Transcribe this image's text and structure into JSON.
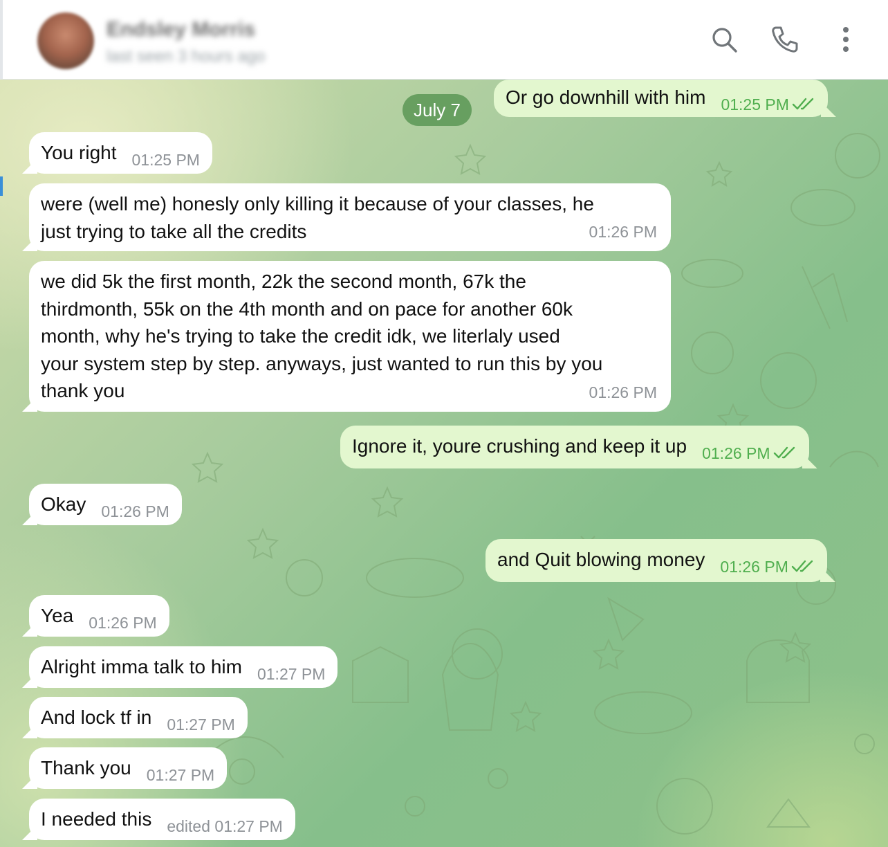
{
  "header": {
    "contact_name": "Endsley Morris",
    "contact_status": "last seen 3 hours ago"
  },
  "chat": {
    "date_divider": "July 7",
    "messages": [
      {
        "dir": "out",
        "text": "Or go downhill with him",
        "time": "01:25 PM",
        "read": true
      },
      {
        "dir": "in",
        "text": "You right",
        "time": "01:25 PM"
      },
      {
        "dir": "in",
        "lines": [
          "were (well me) honesly only killing it because of your classes, he",
          "just trying to take all the credits"
        ],
        "time": "01:26 PM"
      },
      {
        "dir": "in",
        "lines": [
          "we did 5k the first month, 22k the second month, 67k the",
          "thirdmonth, 55k on the 4th month and on pace for another 60k",
          "month, why he's trying to take the credit idk, we literlaly used",
          "your system step by step. anyways, just wanted to run this by you",
          "thank you"
        ],
        "time": "01:26 PM"
      },
      {
        "dir": "out",
        "text": "Ignore it, youre crushing and keep it up",
        "time": "01:26 PM",
        "read": true
      },
      {
        "dir": "in",
        "text": "Okay",
        "time": "01:26 PM"
      },
      {
        "dir": "out",
        "text": "and Quit blowing money",
        "time": "01:26 PM",
        "read": true
      },
      {
        "dir": "in",
        "text": "Yea",
        "time": "01:26 PM"
      },
      {
        "dir": "in",
        "text": "Alright imma talk to him",
        "time": "01:27 PM"
      },
      {
        "dir": "in",
        "text": "And lock tf in",
        "time": "01:27 PM"
      },
      {
        "dir": "in",
        "text": "Thank you",
        "time": "01:27 PM"
      },
      {
        "dir": "in",
        "text": "I needed this",
        "time": "edited 01:27 PM"
      }
    ]
  },
  "icons": {
    "search": "search-icon",
    "call": "phone-icon",
    "menu": "more-vertical-icon",
    "read_receipt": "double-check-icon"
  },
  "colors": {
    "incoming_bubble": "#ffffff",
    "outgoing_bubble": "#e3f7cf",
    "outgoing_meta": "#4fae4e",
    "incoming_meta": "#8e9297",
    "date_pill": "#5a9655"
  }
}
